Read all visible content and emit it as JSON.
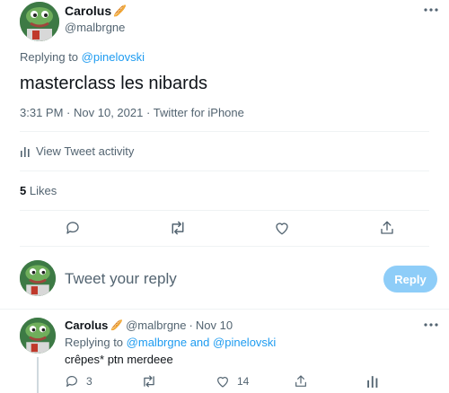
{
  "tweet": {
    "author_name": "Carolus",
    "author_badge_emoji": "🥖",
    "author_handle": "@malbrgne",
    "replying_prefix": "Replying to",
    "replying_to": "@pinelovski",
    "text": "masterclass les nibards",
    "time": "3:31 PM",
    "date": "Nov 10, 2021",
    "source": "Twitter for iPhone",
    "separator": "·",
    "activity_label": "View Tweet activity",
    "likes_count": "5",
    "likes_label": "Likes"
  },
  "composer": {
    "placeholder": "Tweet your reply",
    "reply_button": "Reply"
  },
  "reply": {
    "author_name": "Carolus",
    "author_handle": "@malbrgne",
    "separator": "·",
    "date": "Nov 10",
    "replying_prefix": "Replying to",
    "replying_to_1": "@malbrgne",
    "replying_and": "and",
    "replying_to_2": "@pinelovski",
    "text": "crêpes* ptn merdeee",
    "reply_count": "3",
    "like_count": "14"
  },
  "colors": {
    "accent": "#1d9bf0",
    "muted": "#536471",
    "text": "#0f1419",
    "reply_button_disabled": "#8ecdf8"
  }
}
